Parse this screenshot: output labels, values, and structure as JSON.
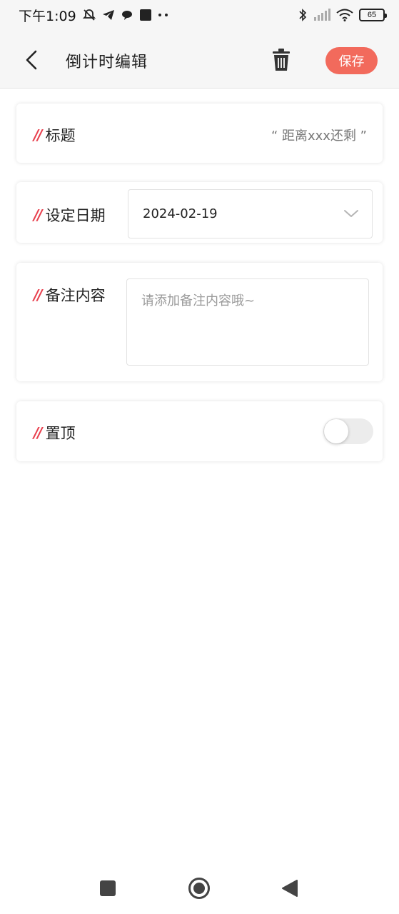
{
  "status_bar": {
    "time": "下午1:09",
    "battery_level": "65",
    "icons": [
      "bell-off-icon",
      "telegram-icon",
      "chat-bubble-icon",
      "square-app-icon",
      "dots-icon",
      "bluetooth-icon",
      "signal-icon",
      "wifi-icon",
      "battery-icon"
    ]
  },
  "header": {
    "title": "倒计时编辑",
    "save_label": "保存"
  },
  "form": {
    "title_field": {
      "label": "标题",
      "value": "“ 距离xxx还剩 ”"
    },
    "date_field": {
      "label": "设定日期",
      "value": "2024-02-19"
    },
    "note_field": {
      "label": "备注内容",
      "placeholder": "请添加备注内容哦~",
      "value": ""
    },
    "pin_field": {
      "label": "置顶",
      "enabled": false
    },
    "label_mark": "//"
  },
  "colors": {
    "accent": "#f26a5c",
    "label_mark": "#e8404e",
    "header_bg": "#f6f6f6"
  }
}
